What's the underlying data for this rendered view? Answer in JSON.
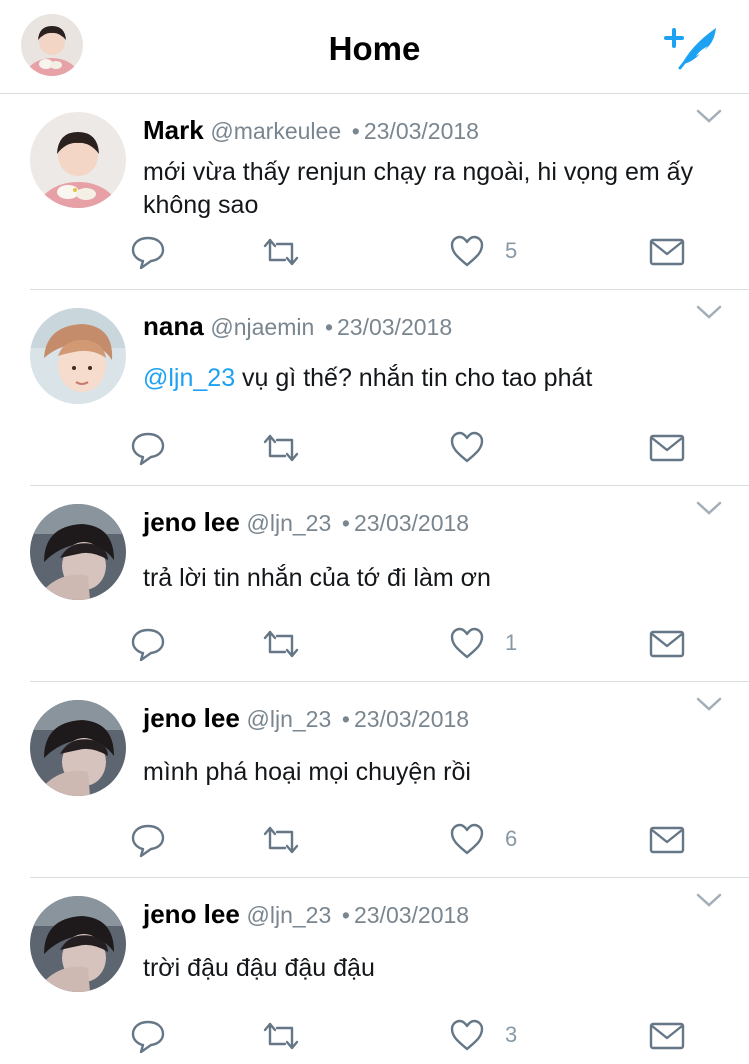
{
  "header": {
    "title": "Home"
  },
  "tweets": [
    {
      "name": "Mark",
      "handle": "@markeulee",
      "separator": "•",
      "date": "23/03/2018",
      "mention": "",
      "text": "mới vừa thấy renjun chạy ra ngoài, hi vọng em ấy không sao",
      "likes": "5",
      "avatar": "avatar-mark"
    },
    {
      "name": "nana",
      "handle": "@njaemin",
      "separator": "•",
      "date": "23/03/2018",
      "mention": "@ljn_23",
      "text": " vụ gì thế? nhắn tin cho tao phát",
      "likes": "",
      "avatar": "avatar-nana"
    },
    {
      "name": "jeno lee",
      "handle": "@ljn_23",
      "separator": "•",
      "date": "23/03/2018",
      "mention": "",
      "text": "trả lời tin nhắn của tớ đi làm ơn",
      "likes": "1",
      "avatar": "avatar-jeno"
    },
    {
      "name": "jeno lee",
      "handle": "@ljn_23",
      "separator": "•",
      "date": "23/03/2018",
      "mention": "",
      "text": "mình phá hoại mọi chuyện rồi",
      "likes": "6",
      "avatar": "avatar-jeno"
    },
    {
      "name": "jeno lee",
      "handle": "@ljn_23",
      "separator": "•",
      "date": "23/03/2018",
      "mention": "",
      "text": "trời đậu đậu đậu đậu",
      "likes": "3",
      "avatar": "avatar-jeno"
    }
  ],
  "colors": {
    "accent": "#1da1f2",
    "icon": "#657786",
    "muted": "#7a868f",
    "divider": "#d8dde1"
  }
}
